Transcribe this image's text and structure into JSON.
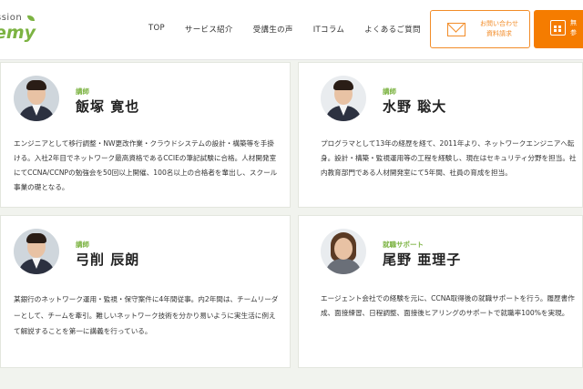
{
  "header": {
    "logo_top": "ssion",
    "logo_bottom": "emy",
    "nav": [
      "TOP",
      "サービス紹介",
      "受講生の声",
      "ITコラム",
      "よくあるご質問"
    ],
    "contact_button": {
      "line1": "お問い合わせ",
      "line2": "資料請求",
      "icon": "mail-icon"
    },
    "seminar_button": {
      "line1": "無",
      "line2": "参",
      "icon": "calendar-icon"
    }
  },
  "instructors": [
    {
      "role": "講師",
      "name": "飯塚 寛也",
      "bio": "エンジニアとして移行調整・NW更改作業・クラウドシステムの設計・構築等を手掛ける。入社2年目でネットワーク最高資格であるCCIEの筆記試験に合格。人材開発室にてCCNA/CCNPの勉強会を50回以上開催、100名以上の合格者を輩出し、スクール事業の礎となる。"
    },
    {
      "role": "講師",
      "name": "水野 聡大",
      "bio": "プログラマとして13年の経歴を経て、2011年より、ネットワークエンジニアへ転身。設計・構築・監視運用等の工程を経験し、現在はセキュリティ分野を担当。社内教育部門である人材開発室にて5年間、社員の育成を担当。"
    },
    {
      "role": "講師",
      "name": "弓削 辰朗",
      "bio": "某銀行のネットワーク運用・監視・保守案件に4年間従事。内2年間は、チームリーダーとして、チームを牽引。難しいネットワーク技術を分かり易いように実生活に例えて解説することを第一に講義を行っている。"
    },
    {
      "role": "就職サポート",
      "name": "尾野 亜理子",
      "bio": "エージェント会社での経験を元に、CCNA取得後の就職サポートを行う。履歴書作成、面接練習、日程調整、面接後ヒアリングのサポートで就職率100%を実現。"
    }
  ],
  "colors": {
    "accent_green": "#7cb342",
    "accent_orange": "#f57c00",
    "background": "#f1f3ee"
  }
}
